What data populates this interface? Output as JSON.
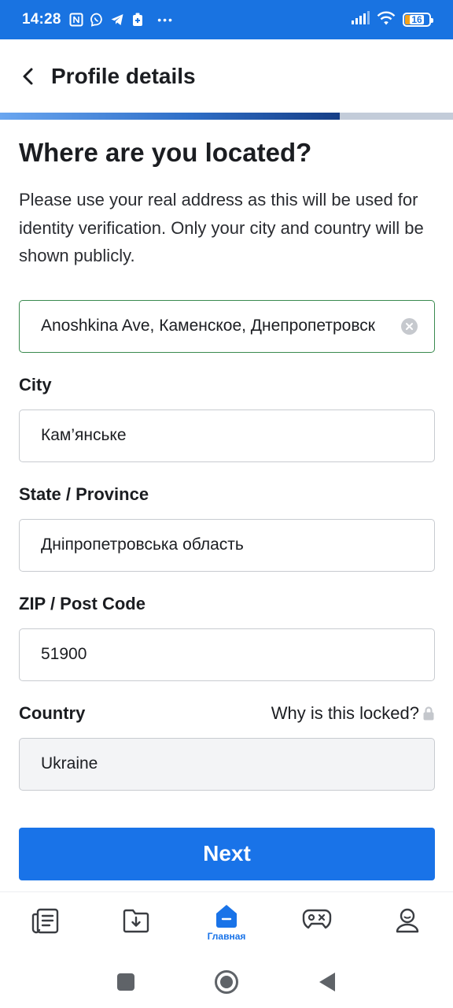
{
  "status_bar": {
    "time": "14:28",
    "battery_level": "16",
    "icons": [
      "nfc-icon",
      "viber-icon",
      "telegram-icon",
      "battery-saver-icon",
      "more-dots-icon",
      "signal-icon",
      "wifi-icon",
      "battery-icon"
    ]
  },
  "header": {
    "title": "Profile details"
  },
  "progress": {
    "value": 0.75
  },
  "form": {
    "heading": "Where are you located?",
    "description": "Please use your real address as this will be used for identity verification. Only your city and country will be shown publicly.",
    "address_value": "Anoshkina Ave, Каменское, Днепропетровск",
    "city_label": "City",
    "city_value": "Кам’янське",
    "state_label": "State / Province",
    "state_value": "Дніпропетровська область",
    "zip_label": "ZIP / Post Code",
    "zip_value": "51900",
    "country_label": "Country",
    "country_locked_link": "Why is this locked?",
    "country_value": "Ukraine",
    "next_label": "Next"
  },
  "bottom_nav": {
    "items": [
      {
        "icon": "news-icon"
      },
      {
        "icon": "download-folder-icon"
      },
      {
        "icon": "home-icon",
        "label": "Главная"
      },
      {
        "icon": "gamepad-icon"
      },
      {
        "icon": "profile-icon"
      }
    ]
  },
  "colors": {
    "status_bar": "#1973e1",
    "primary": "#1973e8",
    "active_border": "#3a8a4f"
  }
}
